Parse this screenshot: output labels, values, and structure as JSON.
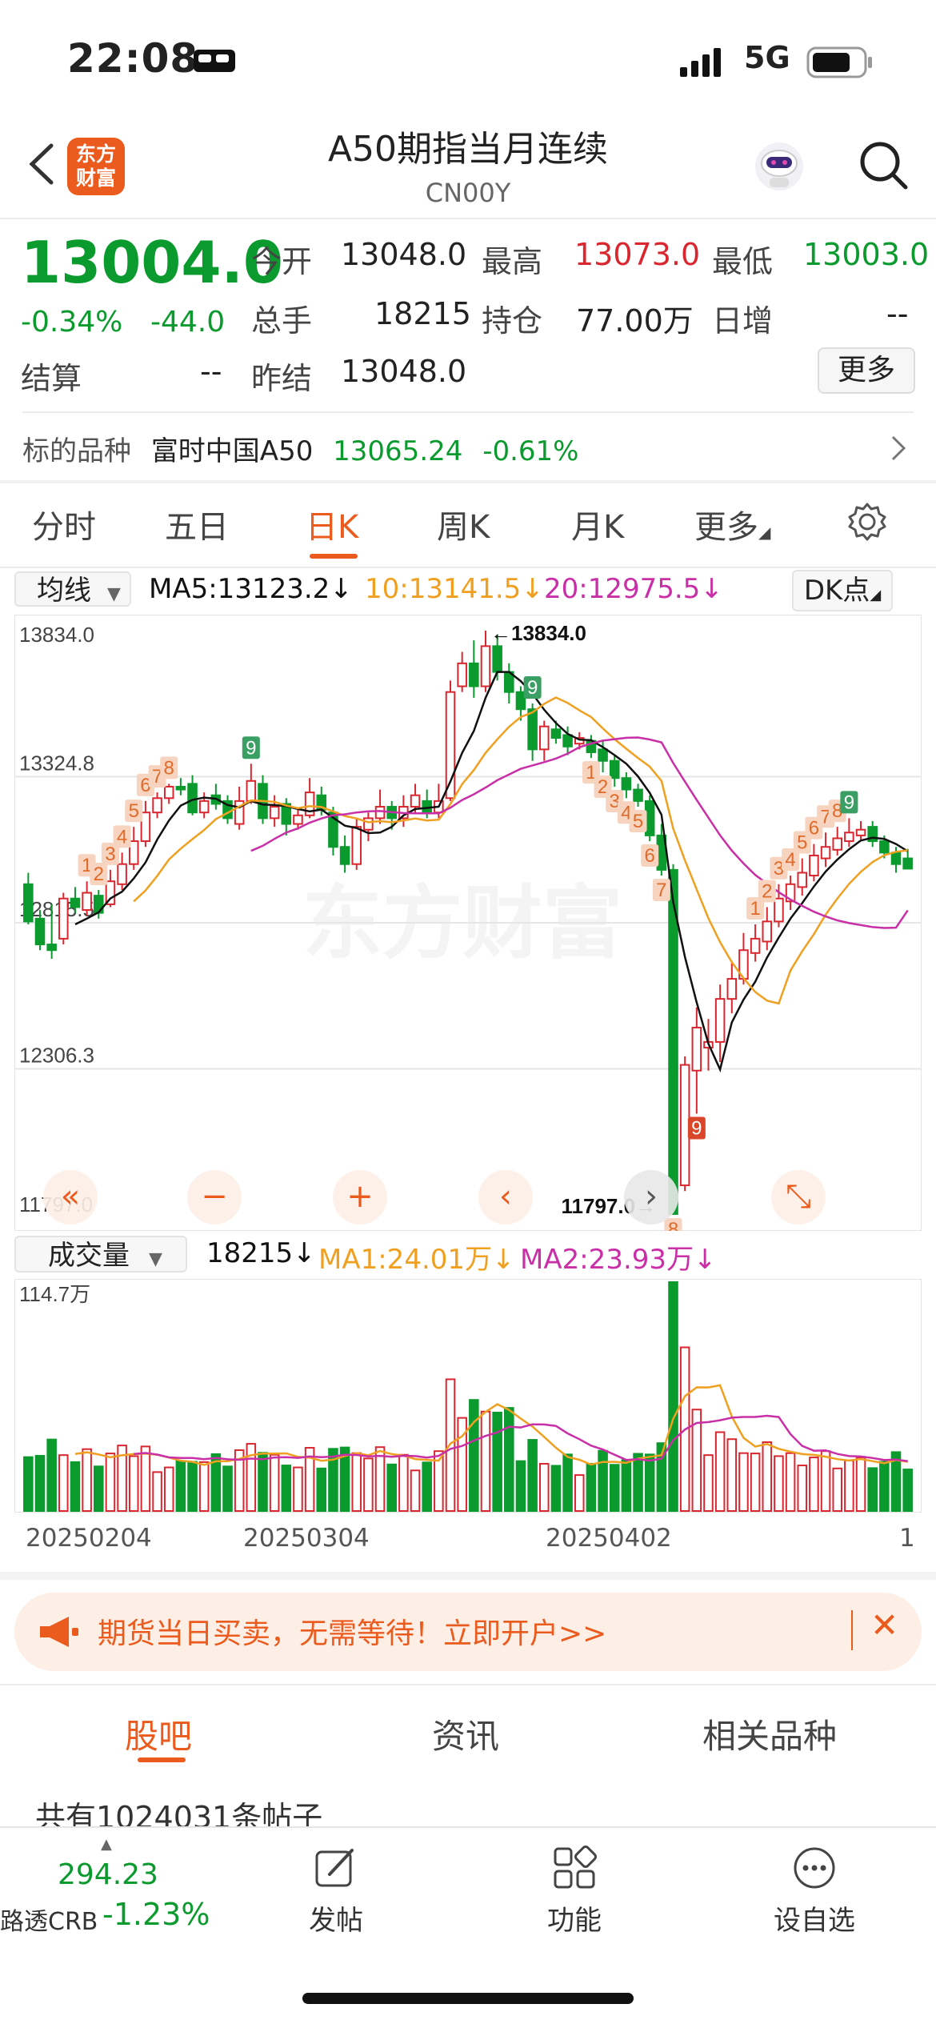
{
  "status_bar": {
    "time": "22:08",
    "network": "5G"
  },
  "header": {
    "logo_text_1": "东方",
    "logo_text_2": "财富",
    "title": "A50期指当月连续",
    "subtitle": "CN00Y"
  },
  "quote": {
    "last_price": "13004.0",
    "change_pct": "-0.34%",
    "change_abs": "-44.0",
    "open_label": "今开",
    "open": "13048.0",
    "high_label": "最高",
    "high": "13073.0",
    "low_label": "最低",
    "low": "13003.0",
    "volume_label": "总手",
    "volume": "18215",
    "oi_label": "持仓",
    "oi": "77.00万",
    "daily_inc_label": "日增",
    "daily_inc": "--",
    "settle_label": "结算",
    "settle": "--",
    "prev_settle_label": "昨结",
    "prev_settle": "13048.0",
    "more_label": "更多"
  },
  "underlying": {
    "label": "标的品种",
    "name": "富时中国A50",
    "price": "13065.24",
    "pct": "-0.61%"
  },
  "tabs": [
    "分时",
    "五日",
    "日K",
    "周K",
    "月K",
    "更多"
  ],
  "ma_row": {
    "select": "均线",
    "ma5": "MA5:13123.2↓",
    "ma10": "10:13141.5↓",
    "ma20": "20:12975.5↓",
    "dk": "DK点"
  },
  "kline": {
    "y_labels": [
      "13834.0",
      "13324.8",
      "12815.5",
      "12306.3",
      "11797.0"
    ],
    "max_label": "←13834.0",
    "min_label": "11797.0→",
    "watermark": "东方财富",
    "seq_labels": [
      "1",
      "2",
      "3",
      "4",
      "5",
      "6",
      "7",
      "8",
      "9",
      "9",
      "1",
      "2",
      "3",
      "4",
      "5",
      "6",
      "7",
      "8",
      "9",
      "1",
      "2",
      "3",
      "4",
      "5",
      "6",
      "7",
      "8",
      "9"
    ]
  },
  "volume": {
    "select": "成交量",
    "value": "18215↓",
    "ma1": "MA1:24.01万↓",
    "ma2": "MA2:23.93万↓",
    "y_label": "114.7万"
  },
  "dates": [
    "20250204",
    "20250304",
    "20250402",
    "1"
  ],
  "colors": {
    "up": "#d9262f",
    "down": "#0a9a2e",
    "accent": "#ea5b1d",
    "ma5": "#111111",
    "ma10": "#f0a020",
    "ma20": "#c92fa7"
  },
  "chart_data": {
    "type": "candlestick",
    "title": "",
    "ylim": [
      11797.0,
      13834.0
    ],
    "candles": [
      [
        12950,
        12820,
        12990,
        12810
      ],
      [
        12830,
        12740,
        12860,
        12720
      ],
      [
        12740,
        12720,
        12880,
        12690
      ],
      [
        12760,
        12900,
        12920,
        12740
      ],
      [
        12900,
        12870,
        12940,
        12850
      ],
      [
        12860,
        12920,
        12960,
        12840
      ],
      [
        12910,
        12850,
        12930,
        12830
      ],
      [
        12880,
        12960,
        13000,
        12870
      ],
      [
        12950,
        13020,
        13060,
        12930
      ],
      [
        13020,
        13100,
        13150,
        13000
      ],
      [
        13100,
        13200,
        13240,
        13080
      ],
      [
        13200,
        13250,
        13270,
        13180
      ],
      [
        13250,
        13290,
        13300,
        13230
      ],
      [
        13290,
        13280,
        13320,
        13260
      ],
      [
        13300,
        13200,
        13330,
        13190
      ],
      [
        13200,
        13240,
        13270,
        13180
      ],
      [
        13260,
        13230,
        13300,
        13210
      ],
      [
        13240,
        13180,
        13260,
        13160
      ],
      [
        13160,
        13240,
        13290,
        13140
      ],
      [
        13240,
        13310,
        13370,
        13230
      ],
      [
        13300,
        13180,
        13330,
        13160
      ],
      [
        13180,
        13220,
        13260,
        13150
      ],
      [
        13230,
        13160,
        13250,
        13120
      ],
      [
        13160,
        13190,
        13210,
        13140
      ],
      [
        13190,
        13270,
        13320,
        13180
      ],
      [
        13260,
        13210,
        13290,
        13190
      ],
      [
        13200,
        13080,
        13220,
        13050
      ],
      [
        13080,
        13020,
        13120,
        12990
      ],
      [
        13020,
        13150,
        13180,
        13000
      ],
      [
        13140,
        13180,
        13200,
        13100
      ],
      [
        13180,
        13220,
        13280,
        13160
      ],
      [
        13220,
        13180,
        13240,
        13140
      ],
      [
        13180,
        13220,
        13260,
        13150
      ],
      [
        13220,
        13260,
        13300,
        13200
      ],
      [
        13240,
        13200,
        13280,
        13180
      ],
      [
        13200,
        13240,
        13300,
        13180
      ],
      [
        13250,
        13620,
        13660,
        13240
      ],
      [
        13640,
        13720,
        13760,
        13620
      ],
      [
        13720,
        13640,
        13800,
        13600
      ],
      [
        13640,
        13780,
        13834,
        13620
      ],
      [
        13780,
        13690,
        13820,
        13660
      ],
      [
        13690,
        13620,
        13720,
        13580
      ],
      [
        13620,
        13560,
        13640,
        13520
      ],
      [
        13560,
        13420,
        13580,
        13380
      ],
      [
        13420,
        13500,
        13520,
        13380
      ],
      [
        13490,
        13460,
        13520,
        13440
      ],
      [
        13470,
        13430,
        13500,
        13400
      ],
      [
        13440,
        13460,
        13480,
        13420
      ],
      [
        13450,
        13410,
        13470,
        13390
      ],
      [
        13420,
        13380,
        13450,
        13340
      ],
      [
        13380,
        13320,
        13400,
        13290
      ],
      [
        13320,
        13280,
        13340,
        13250
      ],
      [
        13280,
        13240,
        13300,
        13220
      ],
      [
        13240,
        13120,
        13260,
        13100
      ],
      [
        13120,
        13000,
        13160,
        12980
      ],
      [
        13000,
        11800,
        13020,
        11797
      ],
      [
        11900,
        12320,
        12350,
        11880
      ],
      [
        12300,
        12450,
        12520,
        12150
      ],
      [
        12380,
        12400,
        12480,
        12300
      ],
      [
        12400,
        12550,
        12600,
        12330
      ],
      [
        12550,
        12620,
        12680,
        12500
      ],
      [
        12620,
        12720,
        12780,
        12600
      ],
      [
        12710,
        12760,
        12810,
        12680
      ],
      [
        12750,
        12820,
        12870,
        12720
      ],
      [
        12820,
        12900,
        12950,
        12800
      ],
      [
        12890,
        12950,
        12980,
        12860
      ],
      [
        12940,
        12990,
        13040,
        12910
      ],
      [
        12980,
        13050,
        13090,
        12960
      ],
      [
        13040,
        13080,
        13130,
        13010
      ],
      [
        13070,
        13110,
        13150,
        13050
      ],
      [
        13100,
        13130,
        13180,
        13080
      ],
      [
        13120,
        13140,
        13170,
        13100
      ],
      [
        13150,
        13100,
        13170,
        13080
      ],
      [
        13100,
        13060,
        13120,
        13040
      ],
      [
        13060,
        13020,
        13080,
        12990
      ],
      [
        13040,
        13004,
        13073,
        13003
      ]
    ],
    "volume_max": "114.7万"
  }
}
